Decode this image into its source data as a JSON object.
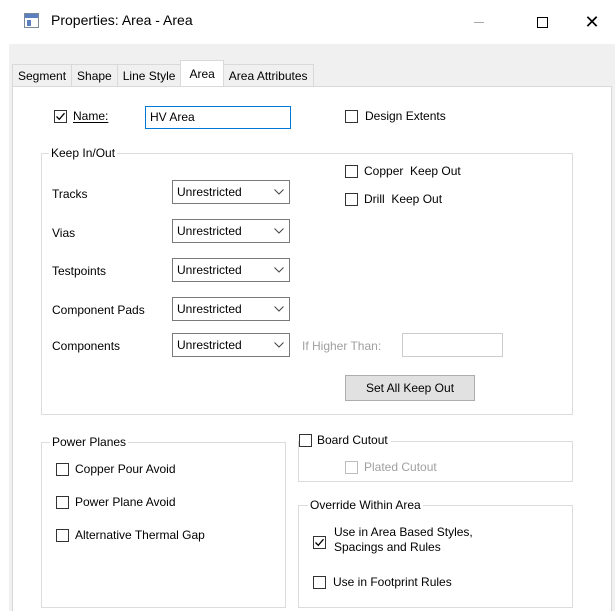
{
  "window": {
    "title": "Properties: Area - Area",
    "icon": "app-icon"
  },
  "tabs": [
    "Segment",
    "Shape",
    "Line Style",
    "Area",
    "Area Attributes"
  ],
  "active_tab": "Area",
  "name": {
    "label": "Name:",
    "checked": true,
    "value": "HV Area"
  },
  "design_extents": {
    "label": "Design Extents",
    "checked": false
  },
  "keep_in_out": {
    "title": "Keep In/Out",
    "rows": [
      {
        "label": "Tracks",
        "value": "Unrestricted"
      },
      {
        "label": "Vias",
        "value": "Unrestricted"
      },
      {
        "label": "Testpoints",
        "value": "Unrestricted"
      },
      {
        "label": "Component Pads",
        "value": "Unrestricted"
      },
      {
        "label": "Components",
        "value": "Unrestricted"
      }
    ],
    "copper_keep_out": {
      "label": "Copper  Keep Out",
      "checked": false
    },
    "drill_keep_out": {
      "label": "Drill  Keep Out",
      "checked": false
    },
    "if_higher_than": {
      "label": "If Higher Than:",
      "value": ""
    },
    "set_all_button": "Set All Keep Out"
  },
  "power_planes": {
    "title": "Power Planes",
    "items": [
      {
        "label": "Copper Pour Avoid",
        "checked": false
      },
      {
        "label": "Power Plane Avoid",
        "checked": false
      },
      {
        "label": "Alternative Thermal Gap",
        "checked": false
      }
    ]
  },
  "board_cutout": {
    "label": "Board Cutout",
    "checked": false,
    "plated": {
      "label": "Plated Cutout",
      "checked": false
    }
  },
  "override_within_area": {
    "title": "Override Within Area",
    "items": [
      {
        "label_line1": "Use in Area Based Styles,",
        "label_line2": "Spacings and Rules",
        "checked": true
      },
      {
        "label_line1": "Use in Footprint Rules",
        "label_line2": "",
        "checked": false
      }
    ]
  }
}
